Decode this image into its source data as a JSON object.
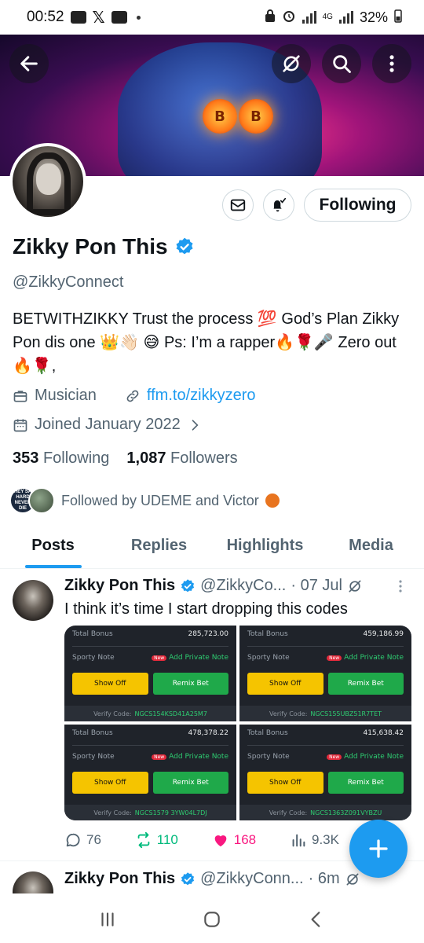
{
  "status_bar": {
    "time": "00:52",
    "network": "4G",
    "battery": "32%"
  },
  "banner": {
    "coin_letter": "B"
  },
  "profile": {
    "name": "Zikky Pon This",
    "handle": "@ZikkyConnect",
    "bio": "BETWITHZIKKY Trust the process 💯 God’s Plan Zikky Pon dis one 👑👋🏻 😅 Ps: I’m a rapper🔥🌹🎤 Zero out🔥🌹,",
    "category": "Musician",
    "link": "ffm.to/zikkyzero",
    "joined": "Joined January 2022",
    "following_count": "353",
    "following_label": "Following",
    "followers_count": "1,087",
    "followers_label": "Followers",
    "followed_by": "Followed by UDEME and Victor",
    "mini_avatar_text": "THEY SAY HARD NEVER DIE"
  },
  "buttons": {
    "following": "Following"
  },
  "tabs": [
    {
      "label": "Posts",
      "active": true
    },
    {
      "label": "Replies",
      "active": false
    },
    {
      "label": "Highlights",
      "active": false
    },
    {
      "label": "Media",
      "active": false
    }
  ],
  "post": {
    "name": "Zikky Pon This",
    "handle": "@ZikkyCo...",
    "time": "· 07 Jul",
    "text": "I think it’s time I start dropping this codes",
    "replies": "76",
    "reposts": "110",
    "likes": "168",
    "views": "9.3K",
    "cards": [
      {
        "total_label": "Total Bonus",
        "amount": "285,723.00",
        "note_label": "Sporty Note",
        "new_badge": "New",
        "add_note": "Add Private Note",
        "show_off": "Show Off",
        "remix": "Remix Bet",
        "verify_label": "Verify Code:",
        "code": "NGCS154KSD41A25M7"
      },
      {
        "total_label": "Total Bonus",
        "amount": "459,186.99",
        "note_label": "Sporty Note",
        "new_badge": "New",
        "add_note": "Add Private Note",
        "show_off": "Show Off",
        "remix": "Remix Bet",
        "verify_label": "Verify Code:",
        "code": "NGCS155UBZ51R7TET"
      },
      {
        "total_label": "Total Bonus",
        "amount": "478,378.22",
        "note_label": "Sporty Note",
        "new_badge": "New",
        "add_note": "Add Private Note",
        "show_off": "Show Off",
        "remix": "Remix Bet",
        "verify_label": "Verify Code:",
        "code": "NGCS1579 3YW04L7DJ"
      },
      {
        "total_label": "Total Bonus",
        "amount": "415,638.42",
        "note_label": "Sporty Note",
        "new_badge": "New",
        "add_note": "Add Private Note",
        "show_off": "Show Off",
        "remix": "Remix Bet",
        "verify_label": "Verify Code:",
        "code": "NGCS1363Z091VYBZU"
      }
    ]
  },
  "post2": {
    "name": "Zikky Pon This",
    "handle": "@ZikkyConn...",
    "time": "· 6m"
  },
  "icons": {
    "back": "arrow-left-icon",
    "grok": "grok-icon",
    "search": "search-icon",
    "more": "more-vertical-icon",
    "mail": "mail-icon",
    "bell": "bell-check-icon",
    "verified": "verified-badge-icon",
    "briefcase": "briefcase-icon",
    "link": "link-icon",
    "calendar": "calendar-icon",
    "reply": "reply-icon",
    "repost": "repost-icon",
    "like": "heart-icon",
    "views": "views-icon",
    "compose": "plus-icon"
  },
  "colors": {
    "accent": "#1d9bf0",
    "repost": "#00ba7c",
    "like": "#f91880",
    "secondary_text": "#536471"
  }
}
